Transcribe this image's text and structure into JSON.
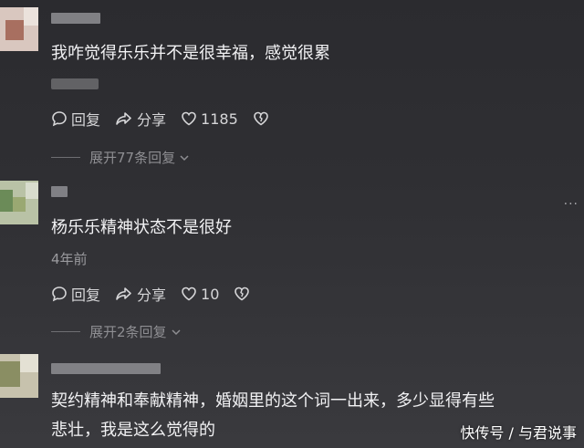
{
  "comments": [
    {
      "text": "我咋觉得乐乐并不是很幸福，感觉很累",
      "reply_label": "回复",
      "share_label": "分享",
      "likes": "1185",
      "expand_label": "展开77条回复"
    },
    {
      "text": "杨乐乐精神状态不是很好",
      "time": "4年前",
      "reply_label": "回复",
      "share_label": "分享",
      "likes": "10",
      "expand_label": "展开2条回复"
    },
    {
      "text_line1": "契约精神和奉献精神，婚姻里的这个词一出来，多少显得有些",
      "text_line2": "悲壮，我是这么觉得的"
    }
  ],
  "more_menu": "···",
  "watermark": "快传号 / 与君说事",
  "icons": [
    "comment-bubble-icon",
    "share-arrow-icon",
    "heart-icon",
    "broken-heart-icon",
    "chevron-down-icon"
  ]
}
